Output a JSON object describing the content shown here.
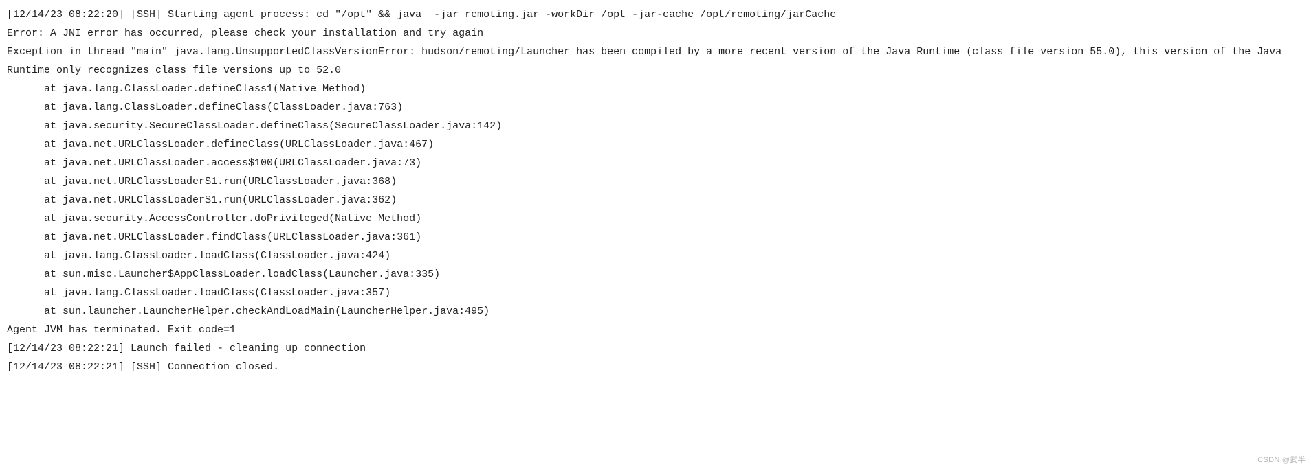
{
  "log": {
    "lines": [
      {
        "indent": false,
        "text": "[12/14/23 08:22:20] [SSH] Starting agent process: cd \"/opt\" && java  -jar remoting.jar -workDir /opt -jar-cache /opt/remoting/jarCache"
      },
      {
        "indent": false,
        "text": "Error: A JNI error has occurred, please check your installation and try again"
      },
      {
        "indent": false,
        "text": "Exception in thread \"main\" java.lang.UnsupportedClassVersionError: hudson/remoting/Launcher has been compiled by a more recent version of the Java Runtime (class file version 55.0), this version of the Java Runtime only recognizes class file versions up to 52.0"
      },
      {
        "indent": true,
        "text": "at java.lang.ClassLoader.defineClass1(Native Method)"
      },
      {
        "indent": true,
        "text": "at java.lang.ClassLoader.defineClass(ClassLoader.java:763)"
      },
      {
        "indent": true,
        "text": "at java.security.SecureClassLoader.defineClass(SecureClassLoader.java:142)"
      },
      {
        "indent": true,
        "text": "at java.net.URLClassLoader.defineClass(URLClassLoader.java:467)"
      },
      {
        "indent": true,
        "text": "at java.net.URLClassLoader.access$100(URLClassLoader.java:73)"
      },
      {
        "indent": true,
        "text": "at java.net.URLClassLoader$1.run(URLClassLoader.java:368)"
      },
      {
        "indent": true,
        "text": "at java.net.URLClassLoader$1.run(URLClassLoader.java:362)"
      },
      {
        "indent": true,
        "text": "at java.security.AccessController.doPrivileged(Native Method)"
      },
      {
        "indent": true,
        "text": "at java.net.URLClassLoader.findClass(URLClassLoader.java:361)"
      },
      {
        "indent": true,
        "text": "at java.lang.ClassLoader.loadClass(ClassLoader.java:424)"
      },
      {
        "indent": true,
        "text": "at sun.misc.Launcher$AppClassLoader.loadClass(Launcher.java:335)"
      },
      {
        "indent": true,
        "text": "at java.lang.ClassLoader.loadClass(ClassLoader.java:357)"
      },
      {
        "indent": true,
        "text": "at sun.launcher.LauncherHelper.checkAndLoadMain(LauncherHelper.java:495)"
      },
      {
        "indent": false,
        "text": "Agent JVM has terminated. Exit code=1"
      },
      {
        "indent": false,
        "text": "[12/14/23 08:22:21] Launch failed - cleaning up connection"
      },
      {
        "indent": false,
        "text": "[12/14/23 08:22:21] [SSH] Connection closed."
      }
    ]
  },
  "watermark": "CSDN @武半"
}
